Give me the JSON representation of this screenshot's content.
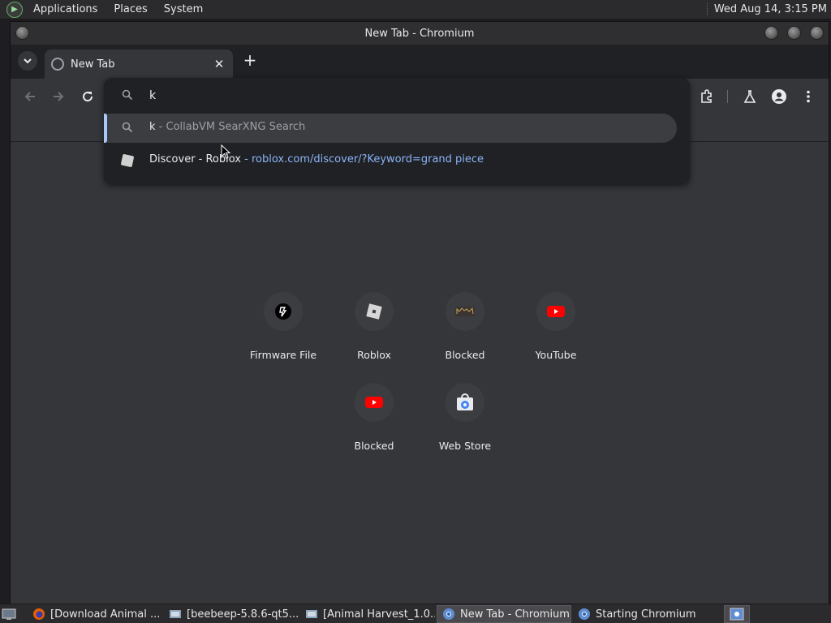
{
  "top_panel": {
    "menus": [
      "Applications",
      "Places",
      "System"
    ],
    "clock": "Wed Aug 14,  3:15 PM"
  },
  "window": {
    "title": "New Tab - Chromium"
  },
  "tabs": {
    "active_tab_title": "New Tab",
    "close_glyph": "✕",
    "new_tab_glyph": "+"
  },
  "omnibox": {
    "input_value": "k",
    "suggestions": [
      {
        "match": "k",
        "rest": " - CollabVM SearXNG Search",
        "icon": "search-icon"
      },
      {
        "title": "Discover - Roblox",
        "separator": " - ",
        "url": "roblox.com/discover/?Keyword=grand piece",
        "icon": "roblox-icon"
      }
    ]
  },
  "shortcuts": [
    {
      "label": "Firmware File",
      "icon": "firmware-file-icon"
    },
    {
      "label": "Roblox",
      "icon": "roblox-icon"
    },
    {
      "label": "Blocked",
      "icon": "blocked-site-icon"
    },
    {
      "label": "YouTube",
      "icon": "youtube-icon"
    },
    {
      "label": "Blocked",
      "icon": "youtube-icon"
    },
    {
      "label": "Web Store",
      "icon": "web-store-icon"
    }
  ],
  "taskbar": {
    "items": [
      {
        "label": "[Download Animal ...",
        "icon": "firefox-icon"
      },
      {
        "label": "[beebeep-5.8.6-qt5...",
        "icon": "file-manager-icon"
      },
      {
        "label": "[Animal Harvest_1.0...",
        "icon": "file-manager-icon"
      },
      {
        "label": "New Tab - Chromium",
        "icon": "chromium-icon"
      },
      {
        "label": "Starting Chromium",
        "icon": "chromium-icon"
      }
    ]
  },
  "colors": {
    "accent": "#a8c7fa",
    "link": "#8ab4f8",
    "youtube_red": "#ff0000"
  }
}
